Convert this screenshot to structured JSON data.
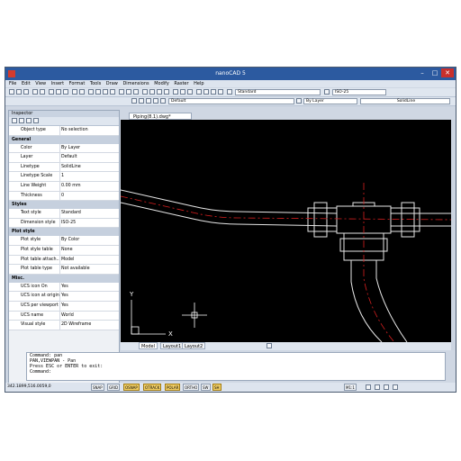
{
  "app": {
    "title": "nanoCAD 5"
  },
  "menu": [
    "File",
    "Edit",
    "View",
    "Insert",
    "Format",
    "Tools",
    "Draw",
    "Dimensions",
    "Modify",
    "Raster",
    "Help"
  ],
  "toolbar": {
    "text_style": "Standard",
    "dim_style": "ISO-25",
    "layer": "Default",
    "color": "By Layer",
    "linetype": "SolidLine"
  },
  "inspector": {
    "title": "Inspector",
    "object_type": {
      "key": "Object type",
      "value": "No selection"
    },
    "sections": [
      {
        "name": "General",
        "rows": [
          {
            "key": "Color",
            "value": "By Layer"
          },
          {
            "key": "Layer",
            "value": "Default"
          },
          {
            "key": "Linetype",
            "value": "SolidLine"
          },
          {
            "key": "Linetype Scale",
            "value": "1"
          },
          {
            "key": "Line Weight",
            "value": "0.00 mm"
          },
          {
            "key": "Thickness",
            "value": "0"
          }
        ]
      },
      {
        "name": "Styles",
        "rows": [
          {
            "key": "Text style",
            "value": "Standard"
          },
          {
            "key": "Dimension style",
            "value": "ISO-25"
          }
        ]
      },
      {
        "name": "Plot style",
        "rows": [
          {
            "key": "Plot style",
            "value": "By Color"
          },
          {
            "key": "Plot style table",
            "value": "None"
          },
          {
            "key": "Plot table attach...",
            "value": "Model"
          },
          {
            "key": "Plot table type",
            "value": "Not available"
          }
        ]
      },
      {
        "name": "Misc.",
        "rows": [
          {
            "key": "UCS icon On",
            "value": "Yes"
          },
          {
            "key": "UCS icon at origin",
            "value": "Yes"
          },
          {
            "key": "UCS per viewport",
            "value": "Yes"
          },
          {
            "key": "UCS name",
            "value": "World"
          },
          {
            "key": "Visual style",
            "value": "2D Wireframe"
          }
        ]
      }
    ]
  },
  "document": {
    "tab": "Piping(8.1).dwg*"
  },
  "layout_tabs": [
    "Model",
    "Layout1",
    "Layout2"
  ],
  "ucs": {
    "x": "X",
    "y": "Y"
  },
  "command": {
    "lines": [
      "Command: pan",
      "PAN,VIEWPAN - Pan",
      "Press ESC or ENTER to exit:",
      "Command:"
    ]
  },
  "status": {
    "coords": "342.1899,516.0059,0",
    "toggles": [
      {
        "label": "SNAP",
        "on": false
      },
      {
        "label": "GRID",
        "on": false
      },
      {
        "label": "OSNAP",
        "on": true
      },
      {
        "label": "OTRACK",
        "on": true
      },
      {
        "label": "POLAR",
        "on": true
      },
      {
        "label": "ORTHO",
        "on": false
      },
      {
        "label": "SW",
        "on": false
      },
      {
        "label": "SH",
        "on": true
      }
    ],
    "scale": "M1:1"
  },
  "colors": {
    "canvas": "#000000",
    "centerline": "#d61f1f",
    "pipe": "#e6e6e6",
    "titlebar": "#2c5aa0"
  }
}
